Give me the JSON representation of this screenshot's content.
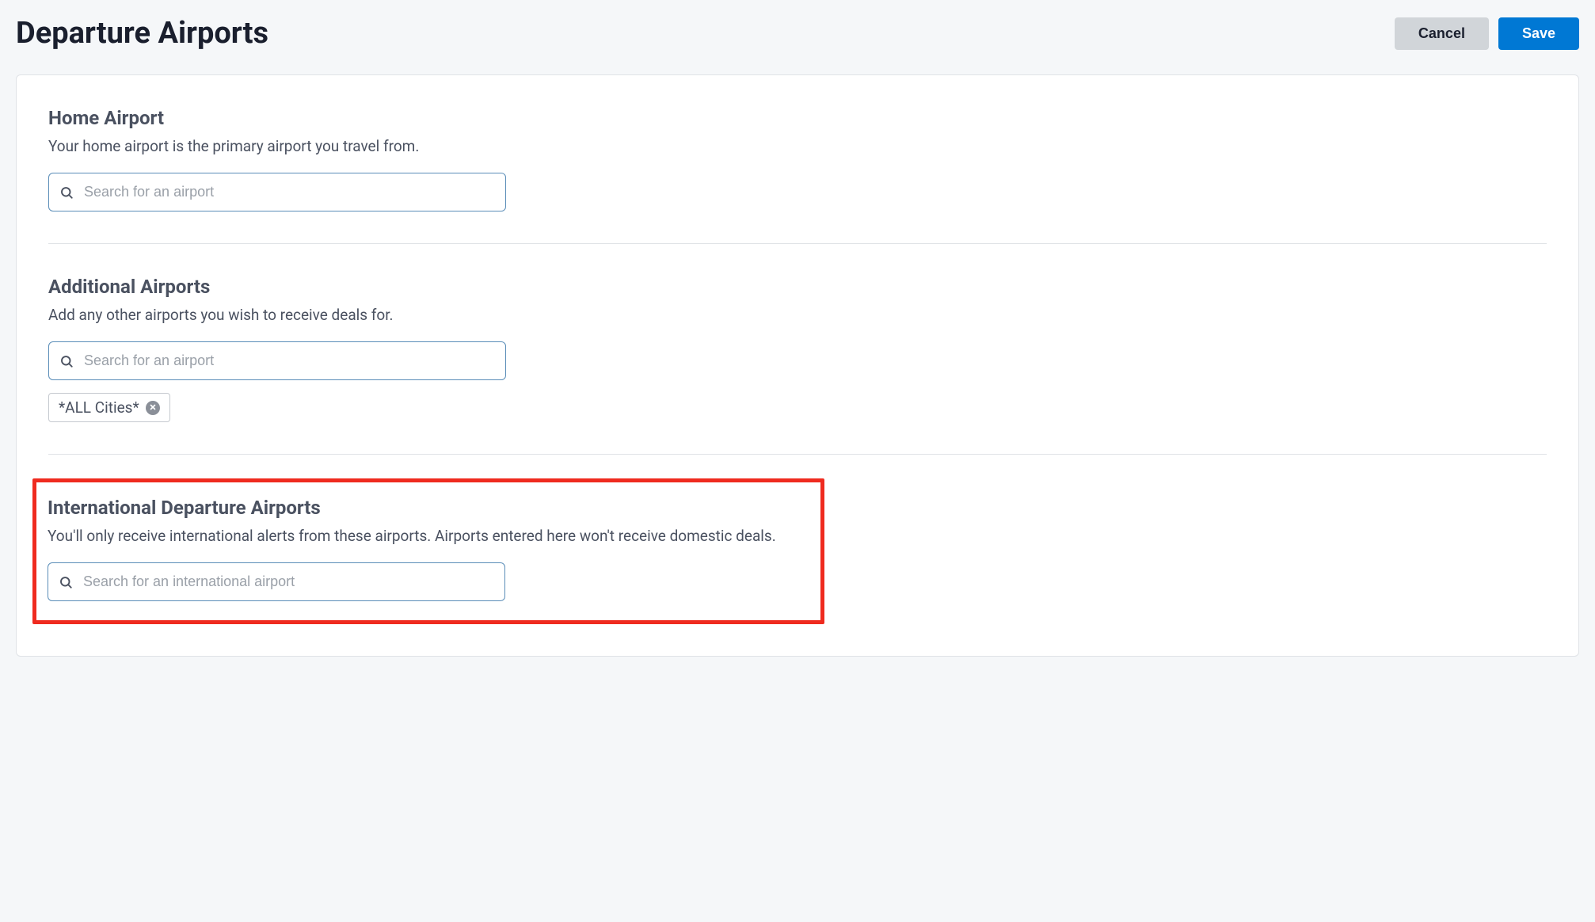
{
  "header": {
    "title": "Departure Airports",
    "cancel_label": "Cancel",
    "save_label": "Save"
  },
  "home_airport": {
    "title": "Home Airport",
    "description": "Your home airport is the primary airport you travel from.",
    "search_placeholder": "Search for an airport"
  },
  "additional_airports": {
    "title": "Additional Airports",
    "description": "Add any other airports you wish to receive deals for.",
    "search_placeholder": "Search for an airport",
    "chips": [
      {
        "label": "*ALL Cities*"
      }
    ]
  },
  "international_airports": {
    "title": "International Departure Airports",
    "description": "You'll only receive international alerts from these airports. Airports entered here won't receive domestic deals.",
    "search_placeholder": "Search for an international airport"
  }
}
